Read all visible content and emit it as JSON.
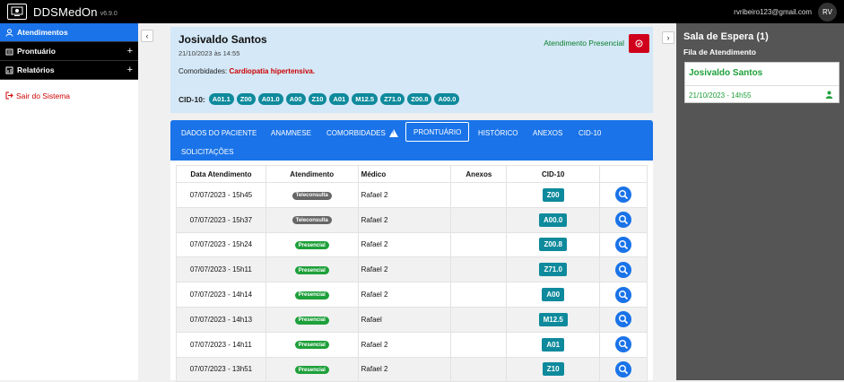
{
  "app": {
    "title": "DDSMedOn",
    "version": "v6.9.0"
  },
  "user": {
    "email": "rvribeiro123@gmail.com",
    "initials": "RV"
  },
  "sidebar": {
    "items": [
      {
        "label": "Atendimentos",
        "icon": "user-icon",
        "active": true
      },
      {
        "label": "Prontuário",
        "icon": "folder-icon",
        "expand": "+"
      },
      {
        "label": "Relatórios",
        "icon": "chart-icon",
        "expand": "+"
      }
    ],
    "logout": "Sair do Sistema"
  },
  "patient": {
    "name": "Josivaldo Santos",
    "date": "21/10/2023 às 14:55",
    "status": "Atendimento Presencial",
    "comorbidades_label": "Comorbidades:",
    "comorbidades_value": "Cardiopatia hipertensiva.",
    "cid_label": "CID-10:",
    "cid_codes": [
      "A01.1",
      "Z00",
      "A01.0",
      "A00",
      "Z10",
      "A01",
      "M12.5",
      "Z71.0",
      "Z00.8",
      "A00.0"
    ]
  },
  "tabs": [
    {
      "label": "DADOS DO PACIENTE"
    },
    {
      "label": "ANAMNESE"
    },
    {
      "label": "COMORBIDADES"
    },
    {
      "label": "PRONTUÁRIO",
      "active": true
    },
    {
      "label": "HISTÓRICO"
    },
    {
      "label": "ANEXOS"
    },
    {
      "label": "CID-10"
    },
    {
      "label": "SOLICITAÇÕES"
    }
  ],
  "table": {
    "headers": [
      "Data Atendimento",
      "Atendimento",
      "Médico",
      "Anexos",
      "CID-10",
      ""
    ],
    "rows": [
      {
        "date": "07/07/2023 - 15h45",
        "type": "Teleconsulta",
        "doctor": "Rafael 2",
        "anexos": "",
        "cid": "Z00"
      },
      {
        "date": "07/07/2023 - 15h37",
        "type": "Teleconsulta",
        "doctor": "Rafael 2",
        "anexos": "",
        "cid": "A00.0"
      },
      {
        "date": "07/07/2023 - 15h24",
        "type": "Presencial",
        "doctor": "Rafael 2",
        "anexos": "",
        "cid": "Z00.8"
      },
      {
        "date": "07/07/2023 - 15h11",
        "type": "Presencial",
        "doctor": "Rafael 2",
        "anexos": "",
        "cid": "Z71.0"
      },
      {
        "date": "07/07/2023 - 14h14",
        "type": "Presencial",
        "doctor": "Rafael 2",
        "anexos": "",
        "cid": "A00"
      },
      {
        "date": "07/07/2023 - 14h13",
        "type": "Presencial",
        "doctor": "Rafael",
        "anexos": "",
        "cid": "M12.5"
      },
      {
        "date": "07/07/2023 - 14h11",
        "type": "Presencial",
        "doctor": "Rafael 2",
        "anexos": "",
        "cid": "A01"
      },
      {
        "date": "07/07/2023 - 13h51",
        "type": "Presencial",
        "doctor": "Rafael 2",
        "anexos": "",
        "cid": "Z10"
      }
    ]
  },
  "waiting": {
    "title": "Sala de Espera (1)",
    "subtitle": "Fila de Atendimento",
    "queue": [
      {
        "name": "Josivaldo Santos",
        "date": "21/10/2023 - 14h55"
      }
    ]
  },
  "colors": {
    "primary": "#1a73e8",
    "teal": "#0e8a9c",
    "green": "#1ea03a",
    "danger": "#d0021b"
  }
}
